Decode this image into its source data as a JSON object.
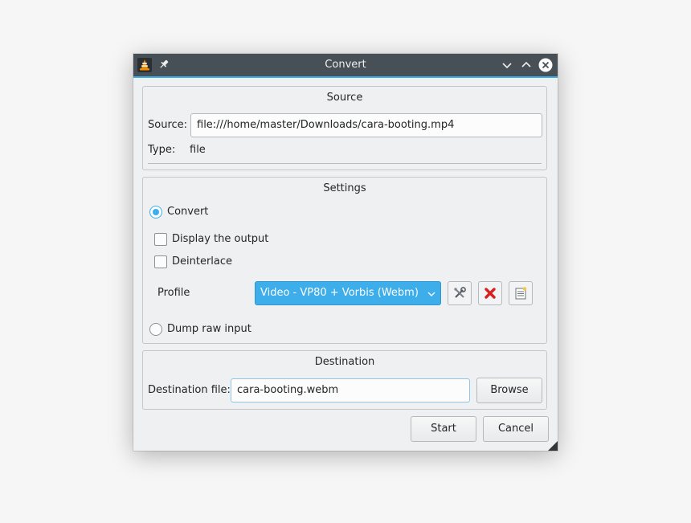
{
  "window": {
    "title": "Convert"
  },
  "source": {
    "heading": "Source",
    "source_label": "Source:",
    "source_value": "file:///home/master/Downloads/cara-booting.mp4",
    "type_label": "Type:",
    "type_value": "file"
  },
  "settings": {
    "heading": "Settings",
    "convert_label": "Convert",
    "convert_selected": true,
    "display_output_label": "Display the output",
    "display_output_checked": false,
    "deinterlace_label": "Deinterlace",
    "deinterlace_checked": false,
    "profile_label": "Profile",
    "profile_selected": "Video - VP80 + Vorbis (Webm)",
    "dump_raw_label": "Dump raw input",
    "dump_raw_selected": false
  },
  "destination": {
    "heading": "Destination",
    "file_label": "Destination file:",
    "file_value": "cara-booting.webm",
    "browse_label": "Browse"
  },
  "actions": {
    "start_label": "Start",
    "cancel_label": "Cancel"
  },
  "icons": {
    "app": "vlc-cone-icon",
    "pin": "pin-icon",
    "minimize": "chevron-down-icon",
    "maximize": "chevron-up-icon",
    "close": "close-icon",
    "edit_profile": "tools-icon",
    "delete_profile": "red-x-icon",
    "new_profile": "new-document-icon"
  },
  "colors": {
    "accent": "#3daee9",
    "titlebar": "#475057",
    "delete_red": "#d81e1e"
  }
}
